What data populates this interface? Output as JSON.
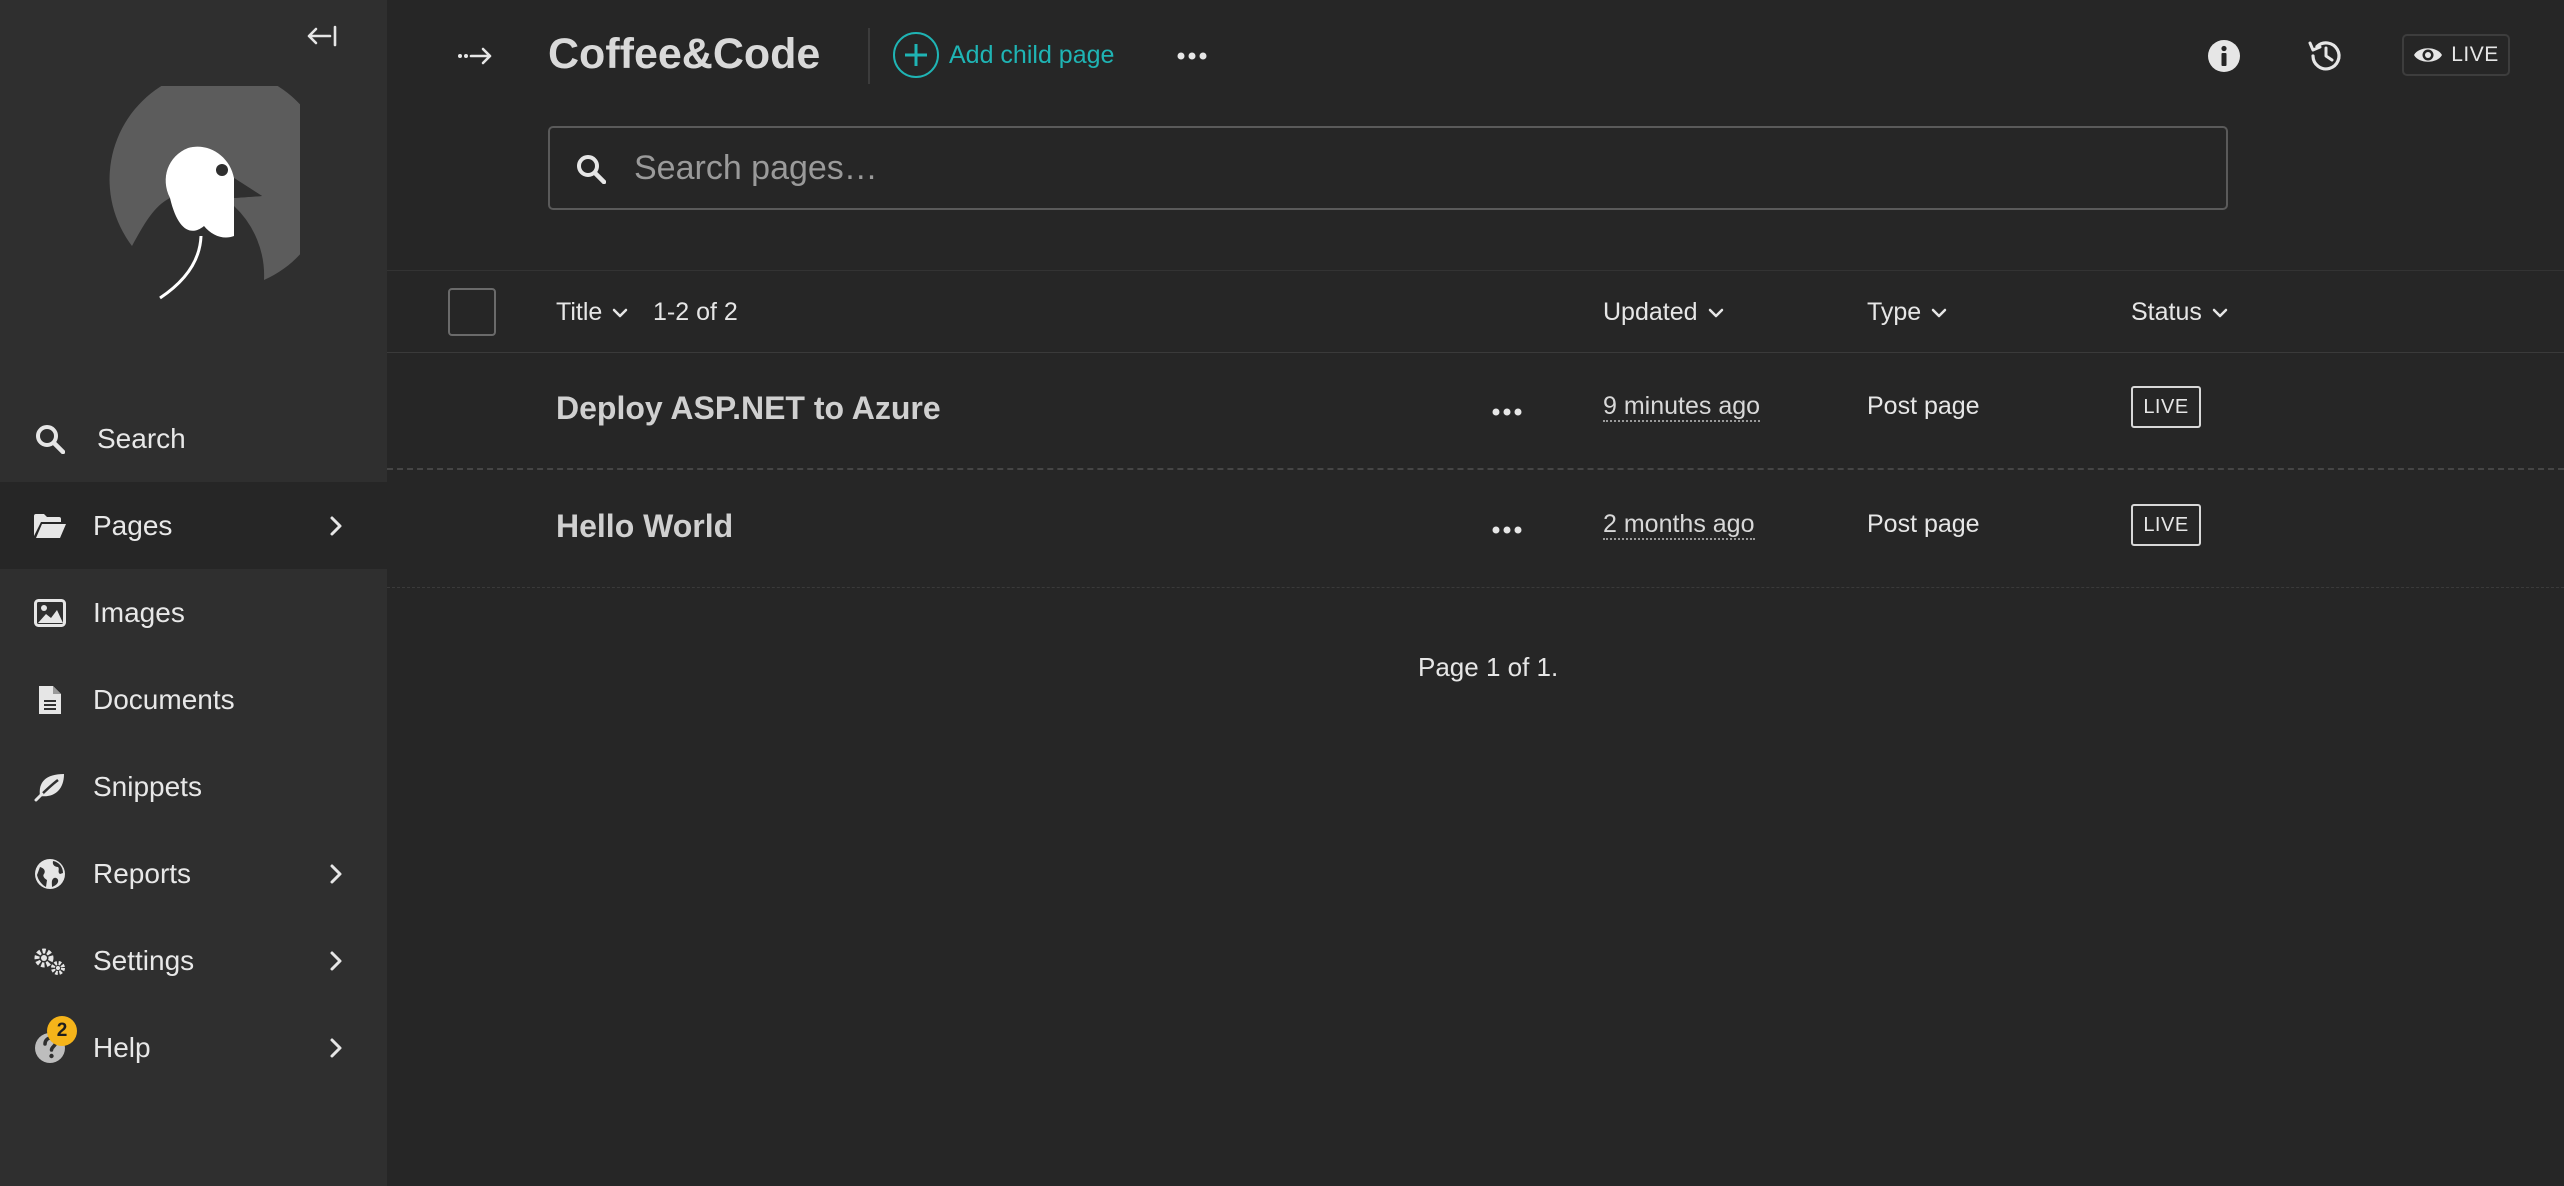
{
  "sidebar": {
    "items": [
      {
        "label": "Search"
      },
      {
        "label": "Pages"
      },
      {
        "label": "Images"
      },
      {
        "label": "Documents"
      },
      {
        "label": "Snippets"
      },
      {
        "label": "Reports"
      },
      {
        "label": "Settings"
      },
      {
        "label": "Help",
        "badge": "2"
      }
    ]
  },
  "header": {
    "title": "Coffee&Code",
    "add_child_label": "Add child page",
    "live_label": "LIVE"
  },
  "search": {
    "placeholder": "Search pages…"
  },
  "table": {
    "columns": {
      "title": "Title",
      "count": "1-2 of 2",
      "updated": "Updated",
      "type": "Type",
      "status": "Status"
    },
    "rows": [
      {
        "title": "Deploy ASP.NET to Azure",
        "updated": "9 minutes ago",
        "type": "Post page",
        "status": "LIVE"
      },
      {
        "title": "Hello World",
        "updated": "2 months ago",
        "type": "Post page",
        "status": "LIVE"
      }
    ],
    "pagination": "Page 1 of 1."
  },
  "colors": {
    "accent": "#1fb4b4",
    "badge": "#f5b41a",
    "sidebar_bg": "#2f2f2f",
    "main_bg": "#262626"
  }
}
